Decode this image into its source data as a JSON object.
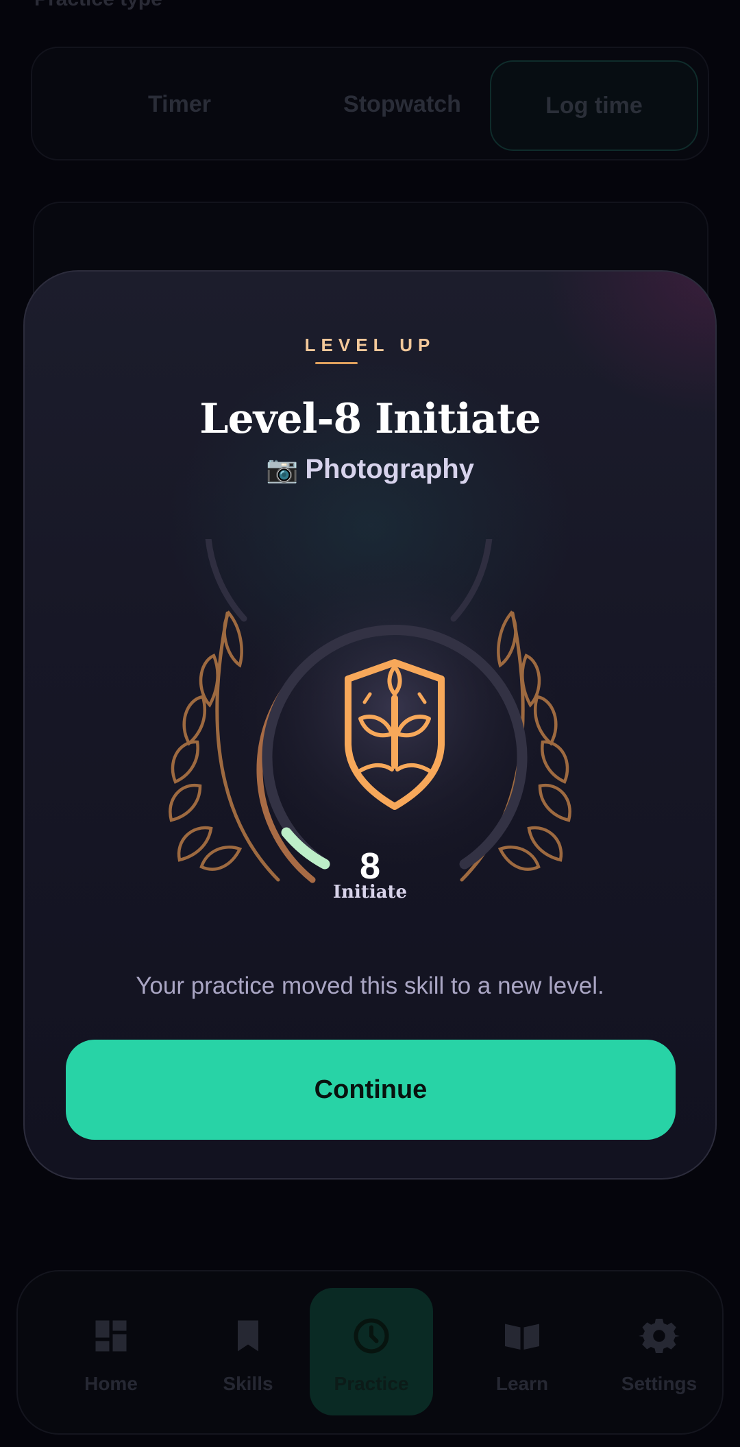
{
  "background": {
    "section_label": "Practice type",
    "practice_types": [
      "Timer",
      "Stopwatch",
      "Log time"
    ],
    "selected_practice_type": "Log time"
  },
  "modal": {
    "eyebrow": "LEVEL UP",
    "title": "Level-8 Initiate",
    "skill_icon": "📷",
    "skill_name": "Photography",
    "level_number": "8",
    "level_name": "Initiate",
    "level_progress": 0.12,
    "message": "Your practice moved this skill to a new level.",
    "continue_label": "Continue"
  },
  "nav": {
    "items": [
      {
        "label": "Home",
        "icon": "dashboard-icon"
      },
      {
        "label": "Skills",
        "icon": "bookmark-icon"
      },
      {
        "label": "Practice",
        "icon": "clock-icon"
      },
      {
        "label": "Learn",
        "icon": "book-icon"
      },
      {
        "label": "Settings",
        "icon": "gear-icon"
      }
    ],
    "active": "Practice"
  },
  "colors": {
    "accent": "#28d3a6",
    "gold": "#f7a85a",
    "progress": "#bdeec8",
    "modal_bg": "#171726"
  }
}
